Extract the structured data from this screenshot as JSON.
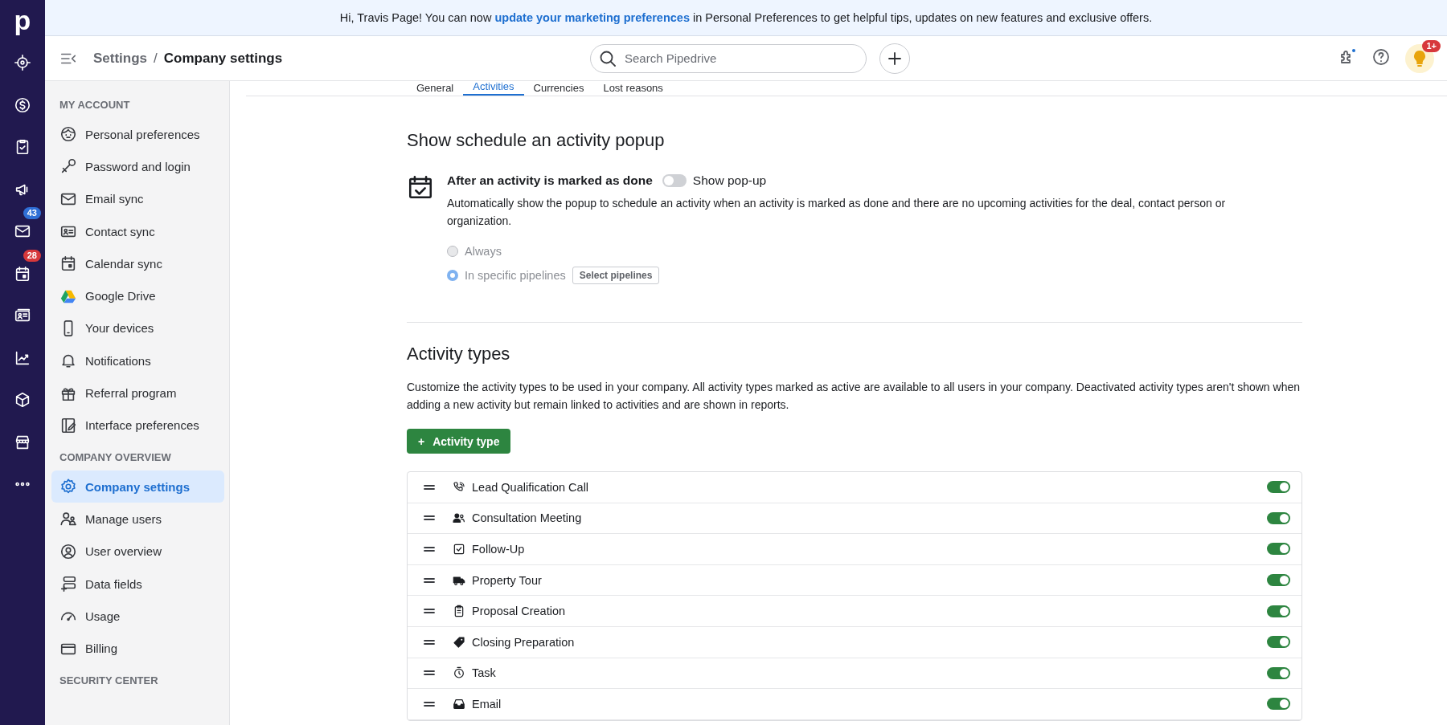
{
  "rail": {
    "logo": "p",
    "mail_badge": {
      "count": "43",
      "color": "#2f6fd6"
    },
    "calendar_badge": {
      "count": "28",
      "color": "#d7383b"
    }
  },
  "banner": {
    "text": "Hi, Travis Page! You can now **update your marketing preferences** in Personal Preferences to get helpful tips, updates on new features and exclusive offers."
  },
  "header": {
    "breadcrumb_parent": "Settings",
    "breadcrumb_separator": "/",
    "breadcrumb_current": "Company settings",
    "search": {
      "placeholder": "Search Pipedrive"
    },
    "tips_badge": {
      "count": "1+",
      "color": "#d7383b"
    }
  },
  "sidebar": {
    "sections": [
      {
        "title": "MY ACCOUNT",
        "items": [
          {
            "label": "Personal preferences",
            "selected": false
          },
          {
            "label": "Password and login",
            "selected": false
          },
          {
            "label": "Email sync",
            "selected": false
          },
          {
            "label": "Contact sync",
            "selected": false
          },
          {
            "label": "Calendar sync",
            "selected": false
          },
          {
            "label": "Google Drive",
            "selected": false
          },
          {
            "label": "Your devices",
            "selected": false
          },
          {
            "label": "Notifications",
            "selected": false
          },
          {
            "label": "Referral program",
            "selected": false
          },
          {
            "label": "Interface preferences",
            "selected": false
          }
        ]
      },
      {
        "title": "COMPANY OVERVIEW",
        "items": [
          {
            "label": "Company settings",
            "selected": true
          },
          {
            "label": "Manage users",
            "selected": false
          },
          {
            "label": "User overview",
            "selected": false
          },
          {
            "label": "Data fields",
            "selected": false
          },
          {
            "label": "Usage",
            "selected": false
          },
          {
            "label": "Billing",
            "selected": false
          }
        ]
      },
      {
        "title": "SECURITY CENTER"
      }
    ]
  },
  "tabs": [
    {
      "label": "General",
      "selected": false
    },
    {
      "label": "Activities",
      "selected": true
    },
    {
      "label": "Currencies",
      "selected": false
    },
    {
      "label": "Lost reasons",
      "selected": false
    }
  ],
  "popup_section": {
    "title": "Show schedule an activity popup",
    "setting_label": "After an activity is marked as done",
    "toggle": {
      "on": false,
      "label": "Show pop-up"
    },
    "description": "Automatically show the popup to schedule an activity when an activity is marked as done and there are no upcoming activities for the deal, contact person or organization.",
    "options_disabled": true,
    "options": [
      {
        "label": "Always",
        "selected": false
      },
      {
        "label": "In specific pipelines",
        "selected": true
      }
    ],
    "select_button": "Select pipelines"
  },
  "activity_types": {
    "title": "Activity types",
    "description": "Customize the activity types to be used in your company. All activity types marked as active are available to all users in your company. Deactivated activity types aren't shown when adding a new activity but remain linked to activities and are shown in reports.",
    "add_button": "Activity type",
    "add_icon": "+",
    "rows": [
      {
        "name": "Lead Qualification Call",
        "active": true
      },
      {
        "name": "Consultation Meeting",
        "active": true
      },
      {
        "name": "Follow-Up",
        "active": true
      },
      {
        "name": "Property Tour",
        "active": true
      },
      {
        "name": "Proposal Creation",
        "active": true
      },
      {
        "name": "Closing Preparation",
        "active": true
      },
      {
        "name": "Task",
        "active": true
      },
      {
        "name": "Email",
        "active": true
      }
    ]
  }
}
